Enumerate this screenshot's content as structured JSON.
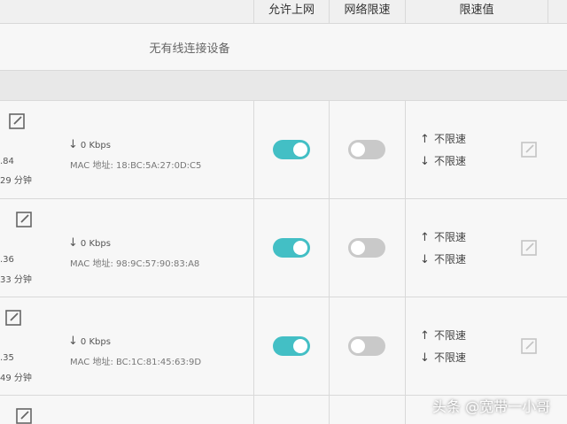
{
  "header": {
    "col_allow": "允许上网",
    "col_limit": "网络限速",
    "col_value": "限速值"
  },
  "wireless": {
    "empty_text": "无有线连接设备"
  },
  "devices": [
    {
      "ip_fragment": ".84",
      "time_fragment": "29 分钟",
      "download": "0 Kbps",
      "mac": "MAC 地址: 18:BC:5A:27:0D:C5",
      "allow_on": true,
      "limit_on": false,
      "up_limit": "不限速",
      "down_limit": "不限速"
    },
    {
      "ip_fragment": ".36",
      "time_fragment": "33 分钟",
      "download": "0 Kbps",
      "mac": "MAC 地址: 98:9C:57:90:83:A8",
      "allow_on": true,
      "limit_on": false,
      "up_limit": "不限速",
      "down_limit": "不限速"
    },
    {
      "ip_fragment": ".35",
      "time_fragment": "49 分钟",
      "download": "0 Kbps",
      "mac": "MAC 地址: BC:1C:81:45:63:9D",
      "allow_on": true,
      "limit_on": false,
      "up_limit": "不限速",
      "down_limit": "不限速"
    }
  ],
  "icons": {
    "up": "↑",
    "down": "↓",
    "edit": "edit-icon"
  },
  "colors": {
    "toggle_on": "#43bfc5",
    "toggle_off": "#c9c9c9"
  },
  "watermark": "头条 @宽带一小哥"
}
